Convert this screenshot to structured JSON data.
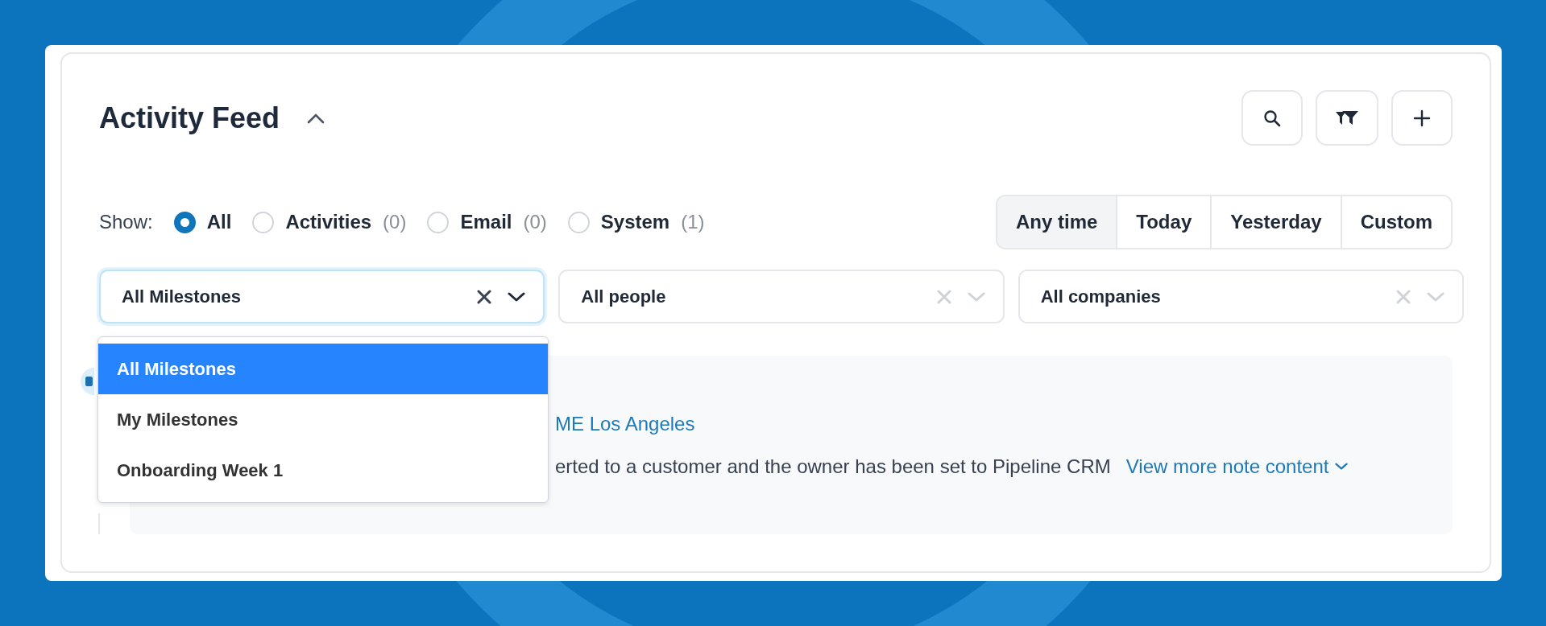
{
  "title": "Activity Feed",
  "toolbar": [
    {
      "kind": "search"
    },
    {
      "kind": "filter"
    },
    {
      "kind": "add"
    }
  ],
  "show": {
    "label": "Show:",
    "options": [
      {
        "label": "All",
        "selected": true
      },
      {
        "label": "Activities",
        "count": "(0)",
        "selected": false
      },
      {
        "label": "Email",
        "count": "(0)",
        "selected": false
      },
      {
        "label": "System",
        "count": "(1)",
        "selected": false
      }
    ]
  },
  "time_range": [
    {
      "label": "Any time",
      "selected": true
    },
    {
      "label": "Today",
      "selected": false
    },
    {
      "label": "Yesterday",
      "selected": false
    },
    {
      "label": "Custom",
      "selected": false
    }
  ],
  "filters": [
    {
      "value": "All Milestones",
      "focused": true
    },
    {
      "value": "All people",
      "focused": false
    },
    {
      "value": "All companies",
      "focused": false
    }
  ],
  "dropdown": [
    {
      "label": "All Milestones",
      "selected": true
    },
    {
      "label": "My Milestones",
      "selected": false
    },
    {
      "label": "Onboarding Week 1",
      "selected": false
    }
  ],
  "feed": [
    {
      "link": "ME Los Angeles",
      "text": "erted to a customer and the owner has been set to Pipeline CRM",
      "more": "View more note content"
    }
  ]
}
